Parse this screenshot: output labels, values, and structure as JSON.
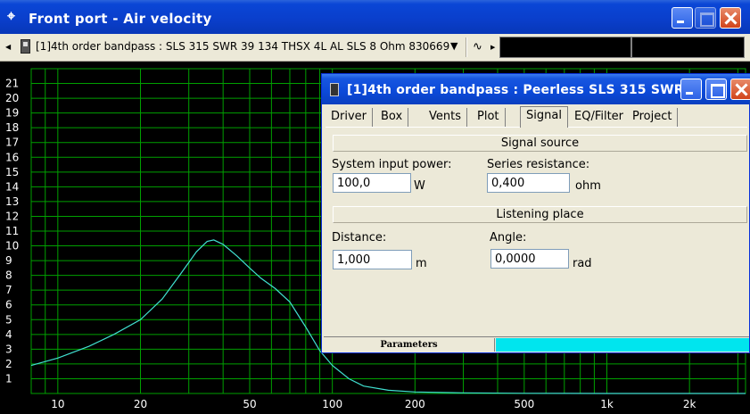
{
  "window": {
    "title": "Front port - Air velocity",
    "icon": "crosshair-icon"
  },
  "toolbar": {
    "project_combo": "[1]4th order bandpass : SLS 315 SWR 39 134 THSX 4L AL SLS 8 Ohm 830669",
    "wave_icon": "waveform-icon"
  },
  "chart_data": {
    "type": "line",
    "title": "",
    "xlabel": "",
    "ylabel": "",
    "x_scale": "log",
    "xlim": [
      8,
      3200
    ],
    "ylim": [
      0,
      22
    ],
    "x_tick_labels": [
      {
        "value": 10,
        "label": "10"
      },
      {
        "value": 20,
        "label": "20"
      },
      {
        "value": 50,
        "label": "50"
      },
      {
        "value": 100,
        "label": "100"
      },
      {
        "value": 200,
        "label": "200"
      },
      {
        "value": 500,
        "label": "500"
      },
      {
        "value": 1000,
        "label": "1k"
      },
      {
        "value": 2000,
        "label": "2k"
      }
    ],
    "y_ticks": [
      1,
      2,
      3,
      4,
      5,
      6,
      7,
      8,
      9,
      10,
      11,
      12,
      13,
      14,
      15,
      16,
      17,
      18,
      19,
      20,
      21
    ],
    "grid": true,
    "series": [
      {
        "color": "#40e0d0",
        "points": [
          [
            8,
            1.9
          ],
          [
            10,
            2.4
          ],
          [
            13,
            3.2
          ],
          [
            16,
            4.0
          ],
          [
            20,
            5.0
          ],
          [
            24,
            6.4
          ],
          [
            28,
            8.1
          ],
          [
            32,
            9.6
          ],
          [
            35,
            10.3
          ],
          [
            37,
            10.4
          ],
          [
            40,
            10.1
          ],
          [
            45,
            9.3
          ],
          [
            50,
            8.5
          ],
          [
            55,
            7.8
          ],
          [
            62,
            7.1
          ],
          [
            70,
            6.2
          ],
          [
            80,
            4.5
          ],
          [
            90,
            2.9
          ],
          [
            100,
            1.9
          ],
          [
            115,
            1.0
          ],
          [
            130,
            0.5
          ],
          [
            160,
            0.22
          ],
          [
            200,
            0.1
          ],
          [
            300,
            0.04
          ],
          [
            500,
            0.01
          ],
          [
            1000,
            0.0
          ],
          [
            3200,
            0.0
          ]
        ]
      }
    ],
    "colors": {
      "background": "#000000",
      "grid": "#00a000",
      "text": "#ffffff"
    }
  },
  "dialog": {
    "title": "[1]4th order bandpass : Peerless SLS 315 SWR ...",
    "tabs": [
      {
        "label": "Driver",
        "active": false
      },
      {
        "label": "Box",
        "active": false
      },
      {
        "label": "Vents",
        "active": false
      },
      {
        "label": "Plot",
        "active": false
      },
      {
        "label": "Signal",
        "active": true
      },
      {
        "label": "EQ/Filter",
        "active": false
      },
      {
        "label": "Project",
        "active": false
      }
    ],
    "signal_source": {
      "header": "Signal source",
      "input_power_label": "System input power:",
      "input_power_value": "100,0",
      "input_power_unit": "W",
      "series_resistance_label": "Series resistance:",
      "series_resistance_value": "0,400",
      "series_resistance_unit": "ohm"
    },
    "listening_place": {
      "header": "Listening place",
      "distance_label": "Distance:",
      "distance_value": "1,000",
      "distance_unit": "m",
      "angle_label": "Angle:",
      "angle_value": "0,0000",
      "angle_unit": "rad"
    },
    "status": {
      "left": "Parameters",
      "progress_fraction": 1.0,
      "progress_color": "#00e5ee"
    }
  }
}
